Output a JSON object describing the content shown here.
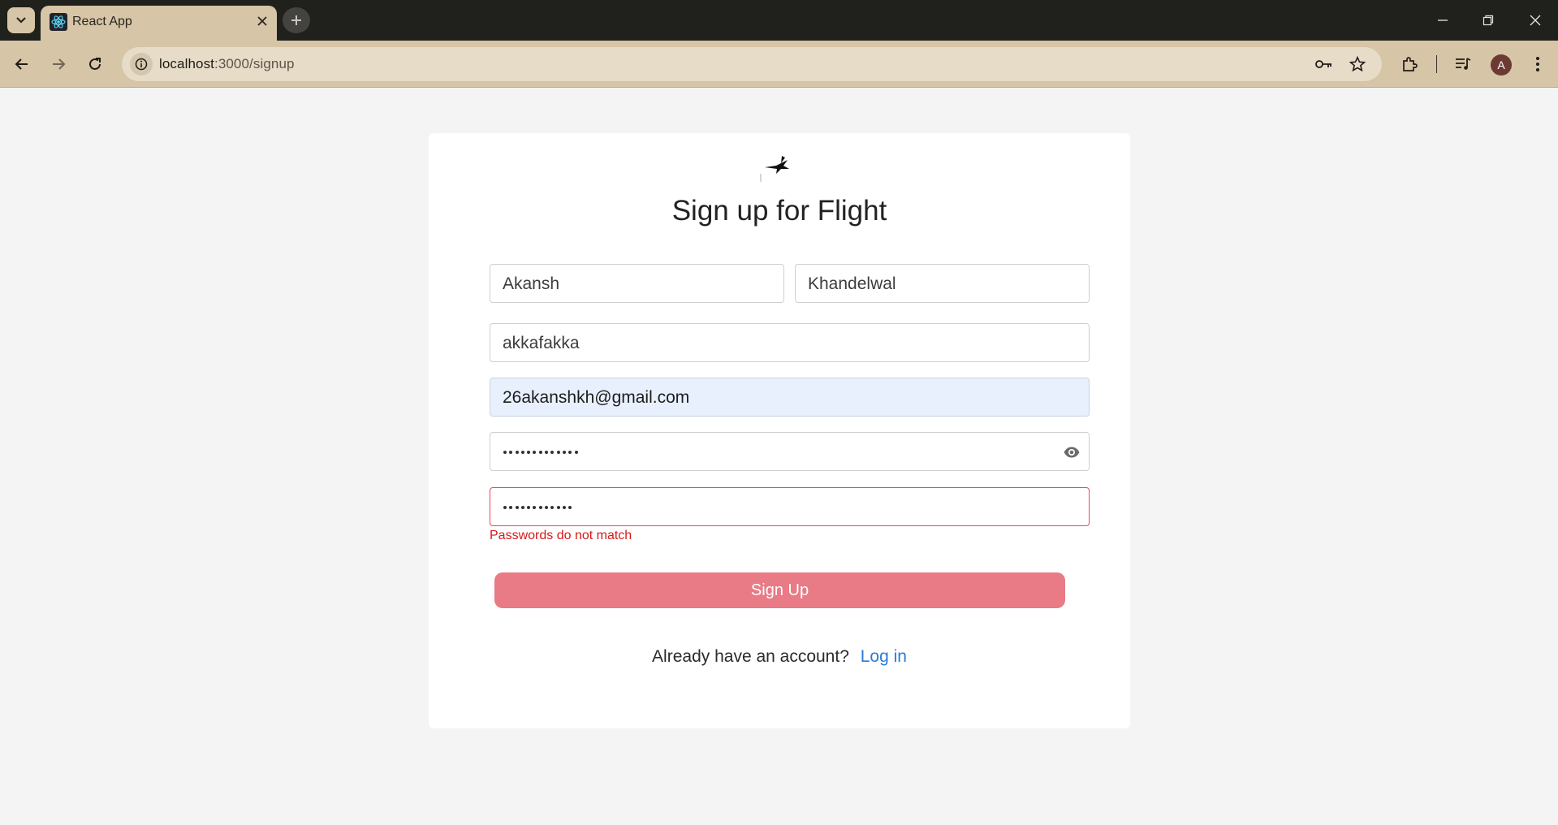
{
  "browser": {
    "tab_title": "React App",
    "url_host": "localhost",
    "url_path": ":3000/signup",
    "profile_initial": "A"
  },
  "form": {
    "title": "Sign up for Flight",
    "first_name": "Akansh",
    "last_name": "Khandelwal",
    "username": "akkafakka",
    "email": "26akanshkh@gmail.com",
    "password_length": 13,
    "confirm_password_length": 12,
    "error": "Passwords do not match",
    "submit_label": "Sign Up",
    "login_prompt": "Already have an account?",
    "login_link": "Log in"
  },
  "colors": {
    "page_bg": "#f4f4f4",
    "button": "#e87b85",
    "error": "#d51a1a",
    "link": "#2a7ad9",
    "autofill": "#e8f0fe"
  },
  "icons": [
    "tab-search-icon",
    "react-icon",
    "close-icon",
    "plus-icon",
    "minimize-icon",
    "restore-icon",
    "back-arrow-icon",
    "forward-arrow-icon",
    "reload-icon",
    "info-icon",
    "key-icon",
    "star-icon",
    "extensions-icon",
    "media-icon",
    "menu-icon",
    "bird-logo-icon",
    "eye-icon"
  ]
}
